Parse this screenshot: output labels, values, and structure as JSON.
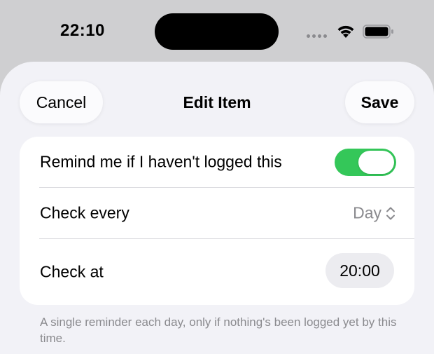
{
  "status_bar": {
    "time": "22:10"
  },
  "nav": {
    "cancel_label": "Cancel",
    "title": "Edit Item",
    "save_label": "Save"
  },
  "settings": {
    "remind_label": "Remind me if I haven't logged this",
    "remind_enabled": true,
    "check_every_label": "Check every",
    "check_every_value": "Day",
    "check_at_label": "Check at",
    "check_at_value": "20:00"
  },
  "footer_note": "A single reminder each day, only if nothing's been logged yet by this time.",
  "colors": {
    "toggle_on": "#34c759",
    "sheet_background": "#f2f2f7",
    "secondary_text": "#8a8a8e"
  }
}
